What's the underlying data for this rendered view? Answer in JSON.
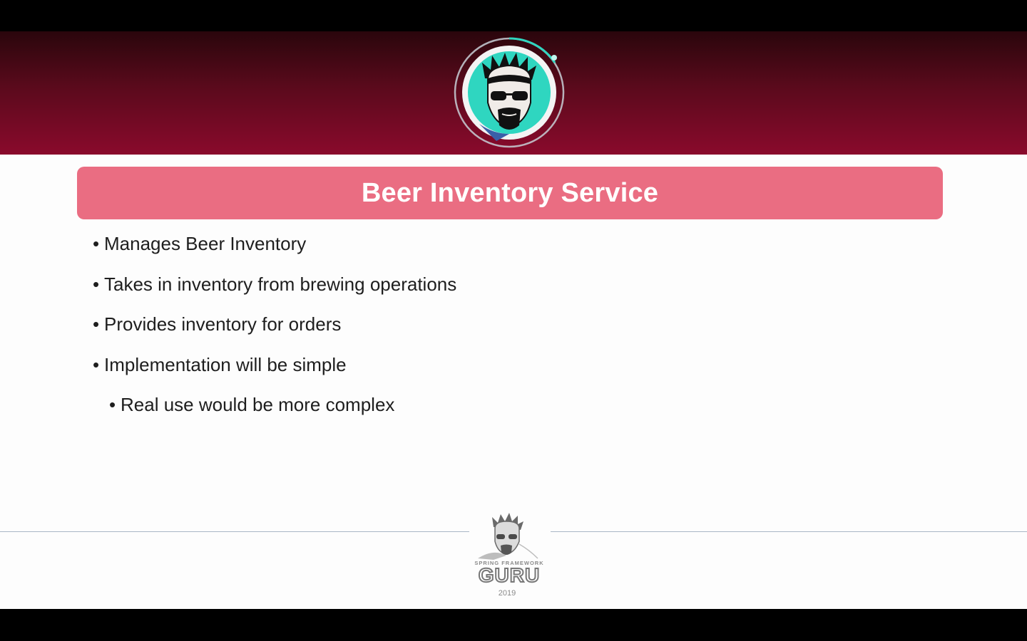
{
  "slide": {
    "title": "Beer Inventory Service",
    "bullets": [
      "Manages Beer Inventory",
      "Takes in inventory from brewing operations",
      "Provides inventory for orders",
      "Implementation will be simple"
    ],
    "sub_bullets": [
      "Real use would be more complex"
    ],
    "bullet_glyph": "•"
  },
  "footer": {
    "brand_small": "SPRING FRAMEWORK",
    "brand": "GURU",
    "year": "2019"
  },
  "colors": {
    "header_dark": "#2a060c",
    "header_light": "#8a0a2c",
    "title_bar": "#ea6d82",
    "avatar_bg": "#2fd6c0"
  },
  "icons": {
    "header": "guru-avatar-icon",
    "footer": "guru-logo-icon"
  }
}
